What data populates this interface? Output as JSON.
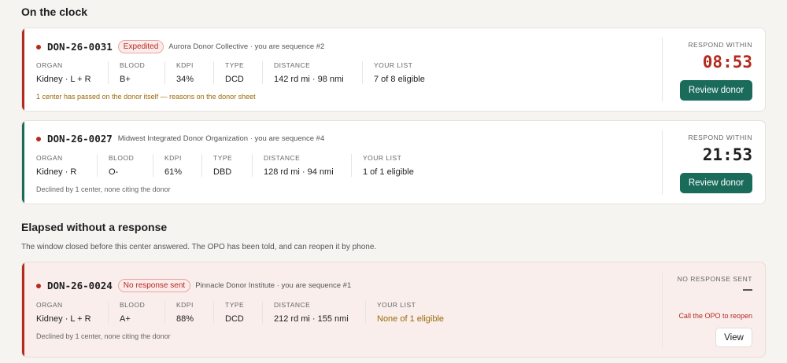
{
  "sections": {
    "on_clock_title": "On the clock",
    "elapsed_title": "Elapsed without a response",
    "elapsed_subtitle": "The window closed before this center answered. The OPO has been told, and can reopen it by phone."
  },
  "colors": {
    "accent_red": "#b52a1e",
    "accent_green": "#1a6b5a",
    "amber": "#9a6a0a"
  },
  "field_labels": {
    "organ": "ORGAN",
    "blood": "BLOOD",
    "kdpi": "KDPI",
    "type": "TYPE",
    "distance": "DISTANCE",
    "your_list": "YOUR LIST"
  },
  "offers": [
    {
      "id": "DON-26-0031",
      "badge": "Expedited",
      "org": "Aurora Donor Collective · you are sequence #2",
      "organ": "Kidney · L + R",
      "blood": "B+",
      "kdpi": "34%",
      "type": "DCD",
      "distance": "142 rd mi · 98 nmi",
      "your_list": "7 of 8 eligible",
      "note": "1 center has passed on the donor itself — reasons on the donor sheet",
      "respond_label": "RESPOND WITHIN",
      "timer": "08:53",
      "button": "Review donor"
    },
    {
      "id": "DON-26-0027",
      "org": "Midwest Integrated Donor Organization · you are sequence #4",
      "organ": "Kidney · R",
      "blood": "O-",
      "kdpi": "61%",
      "type": "DBD",
      "distance": "128 rd mi · 94 nmi",
      "your_list": "1 of 1 eligible",
      "note": "Declined by 1 center, none citing the donor",
      "respond_label": "RESPOND WITHIN",
      "timer": "21:53",
      "button": "Review donor"
    }
  ],
  "elapsed": [
    {
      "id": "DON-26-0024",
      "badge": "No response sent",
      "org": "Pinnacle Donor Institute · you are sequence #1",
      "organ": "Kidney · L + R",
      "blood": "A+",
      "kdpi": "88%",
      "type": "DCD",
      "distance": "212 rd mi · 155 nmi",
      "your_list": "None of 1 eligible",
      "note": "Declined by 1 center, none citing the donor",
      "status_label": "NO RESPONSE SENT",
      "call_note": "Call the OPO to reopen",
      "button": "View"
    }
  ]
}
